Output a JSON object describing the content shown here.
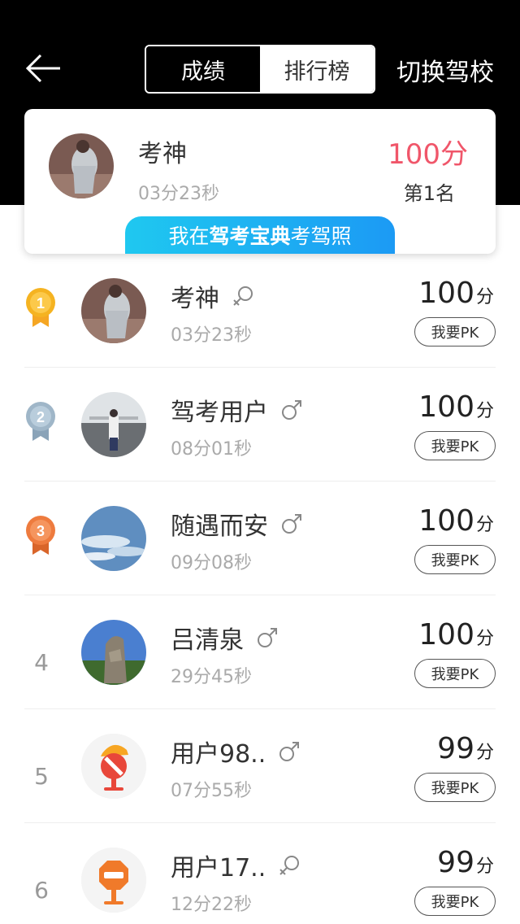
{
  "header": {
    "back_icon": "back-arrow-icon",
    "tabs": [
      {
        "label": "成绩",
        "active": true
      },
      {
        "label": "排行榜",
        "active": false
      }
    ],
    "switch_school": "切换驾校"
  },
  "card": {
    "name": "考神",
    "time": "03分23秒",
    "score": "100分",
    "rank": "第1名",
    "banner_prefix": "我在",
    "banner_brand": "驾考宝典",
    "banner_suffix": "考驾照"
  },
  "list": [
    {
      "rank": "1",
      "name": "考神",
      "time": "03分23秒",
      "score": "100",
      "unit": "分",
      "pk": "我要PK",
      "gender": "female"
    },
    {
      "rank": "2",
      "name": "驾考用户",
      "time": "08分01秒",
      "score": "100",
      "unit": "分",
      "pk": "我要PK",
      "gender": "male"
    },
    {
      "rank": "3",
      "name": "随遇而安",
      "time": "09分08秒",
      "score": "100",
      "unit": "分",
      "pk": "我要PK",
      "gender": "male"
    },
    {
      "rank": "4",
      "name": "吕清泉",
      "time": "29分45秒",
      "score": "100",
      "unit": "分",
      "pk": "我要PK",
      "gender": "male"
    },
    {
      "rank": "5",
      "name": "用户98..",
      "time": "07分55秒",
      "score": "99",
      "unit": "分",
      "pk": "我要PK",
      "gender": "male"
    },
    {
      "rank": "6",
      "name": "用户17..",
      "time": "12分22秒",
      "score": "99",
      "unit": "分",
      "pk": "我要PK",
      "gender": "female"
    }
  ],
  "colors": {
    "header_bg": "#000000",
    "score_accent": "#f0566a",
    "banner_from": "#1fc8f0",
    "banner_to": "#1c9af4",
    "gold": "#f5b321",
    "silver": "#9fb6c8",
    "bronze": "#ee7b3e"
  }
}
